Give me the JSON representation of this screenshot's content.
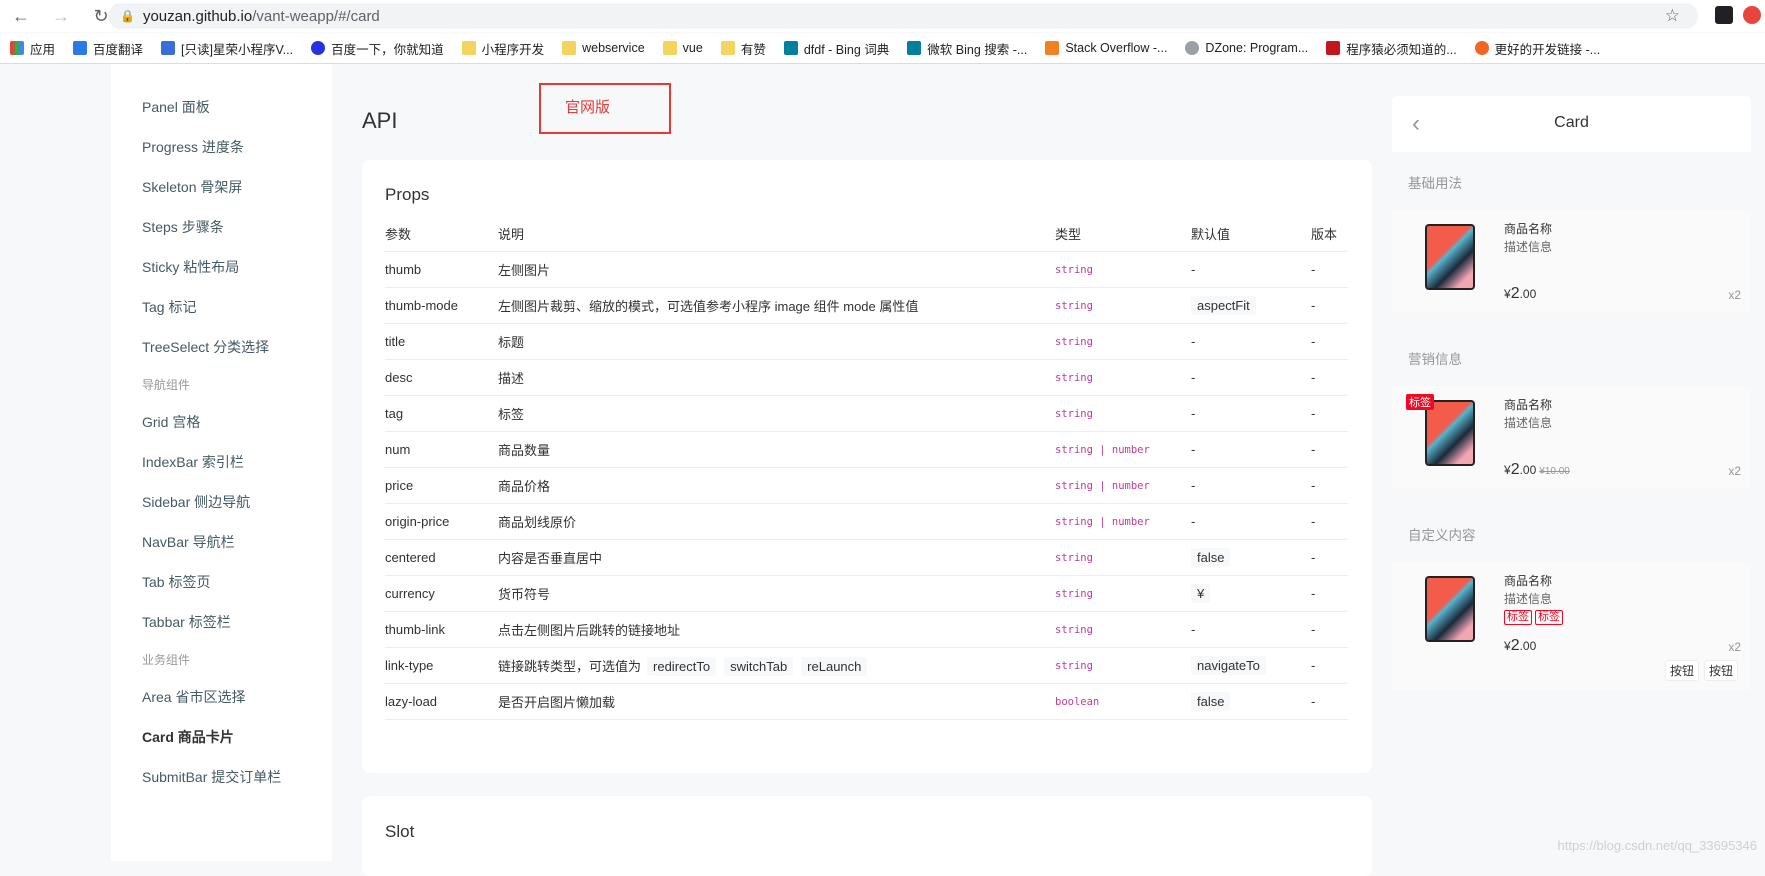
{
  "browser": {
    "url_host": "youzan.github.io",
    "url_path": "/vant-weapp/#/card",
    "bookmarks": [
      "应用",
      "百度翻译",
      "[只读]星荣小程序V...",
      "百度一下，你就知道",
      "小程序开发",
      "webservice",
      "vue",
      "有赞",
      "dfdf - Bing 词典",
      "微软 Bing 搜索 -...",
      "Stack Overflow -...",
      "DZone: Program...",
      "程序猿必须知道的...",
      "更好的开发链接 -..."
    ]
  },
  "sidebar": {
    "items": [
      "Panel 面板",
      "Progress 进度条",
      "Skeleton 骨架屏",
      "Steps 步骤条",
      "Sticky 粘性布局",
      "Tag 标记",
      "TreeSelect 分类选择"
    ],
    "group_nav": "导航组件",
    "nav_items": [
      "Grid 宫格",
      "IndexBar 索引栏",
      "Sidebar 侧边导航",
      "NavBar 导航栏",
      "Tab 标签页",
      "Tabbar 标签栏"
    ],
    "group_biz": "业务组件",
    "biz_items": [
      "Area 省市区选择",
      "Card 商品卡片",
      "SubmitBar 提交订单栏"
    ]
  },
  "main": {
    "api_title": "API",
    "annotation": "官网版",
    "props_title": "Props",
    "headers": [
      "参数",
      "说明",
      "类型",
      "默认值",
      "版本"
    ],
    "rows": [
      {
        "name": "thumb",
        "desc": "左侧图片",
        "type": "string",
        "default": "-",
        "version": "-"
      },
      {
        "name": "thumb-mode",
        "desc": "左侧图片裁剪、缩放的模式，可选值参考小程序 image 组件 mode 属性值",
        "type": "string",
        "default": "aspectFit",
        "version": "-"
      },
      {
        "name": "title",
        "desc": "标题",
        "type": "string",
        "default": "-",
        "version": "-"
      },
      {
        "name": "desc",
        "desc": "描述",
        "type": "string",
        "default": "-",
        "version": "-"
      },
      {
        "name": "tag",
        "desc": "标签",
        "type": "string",
        "default": "-",
        "version": "-"
      },
      {
        "name": "num",
        "desc": "商品数量",
        "type": "string | number",
        "default": "-",
        "version": "-"
      },
      {
        "name": "price",
        "desc": "商品价格",
        "type": "string | number",
        "default": "-",
        "version": "-"
      },
      {
        "name": "origin-price",
        "desc": "商品划线原价",
        "type": "string | number",
        "default": "-",
        "version": "-"
      },
      {
        "name": "centered",
        "desc": "内容是否垂直居中",
        "type": "string",
        "default": "false",
        "version": "-"
      },
      {
        "name": "currency",
        "desc": "货币符号",
        "type": "string",
        "default": "¥",
        "version": "-"
      },
      {
        "name": "thumb-link",
        "desc": "点击左侧图片后跳转的链接地址",
        "type": "string",
        "default": "-",
        "version": "-"
      },
      {
        "name": "link-type",
        "desc": "链接跳转类型，可选值为",
        "desc_codes": [
          "redirectTo",
          "switchTab",
          "reLaunch"
        ],
        "type": "string",
        "default": "navigateTo",
        "version": "-"
      },
      {
        "name": "lazy-load",
        "desc": "是否开启图片懒加载",
        "type": "boolean",
        "default": "false",
        "version": "-"
      }
    ],
    "slot_title": "Slot"
  },
  "preview": {
    "title": "Card",
    "sections": [
      "基础用法",
      "营销信息",
      "自定义内容"
    ],
    "goods_title": "商品名称",
    "goods_desc": "描述信息",
    "currency": "¥",
    "price_int": "2",
    "price_dec": ".00",
    "origin_price": "¥10.00",
    "num": "x2",
    "tag": "标签",
    "button": "按钮"
  },
  "watermark": "https://blog.csdn.net/qq_33695346"
}
